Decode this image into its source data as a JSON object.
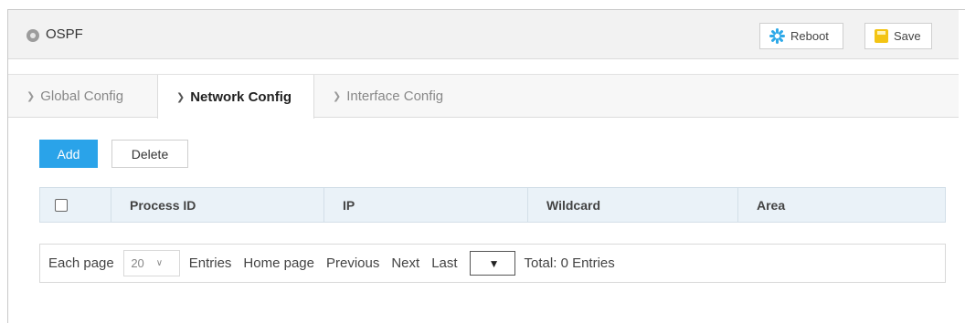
{
  "header": {
    "title": "OSPF",
    "reboot_label": "Reboot",
    "save_label": "Save"
  },
  "tabs": [
    {
      "label": "Global Config",
      "active": false
    },
    {
      "label": "Network Config",
      "active": true
    },
    {
      "label": "Interface Config",
      "active": false
    }
  ],
  "actions": {
    "add_label": "Add",
    "delete_label": "Delete"
  },
  "table": {
    "columns": [
      "Process ID",
      "IP",
      "Wildcard",
      "Area"
    ],
    "rows": []
  },
  "pager": {
    "each_page_label": "Each page",
    "page_size": "20",
    "entries_label": "Entries",
    "home_label": "Home page",
    "previous_label": "Previous",
    "next_label": "Next",
    "last_label": "Last",
    "total_label": "Total: 0 Entries"
  },
  "colors": {
    "accent": "#2aa3e9",
    "save_icon": "#f3c414",
    "table_header_bg": "#eaf2f8"
  },
  "icons": [
    "status-dot-icon",
    "reboot-spinner-icon",
    "save-icon",
    "chevron-right-icon",
    "chevron-down-icon",
    "checkbox-icon"
  ]
}
